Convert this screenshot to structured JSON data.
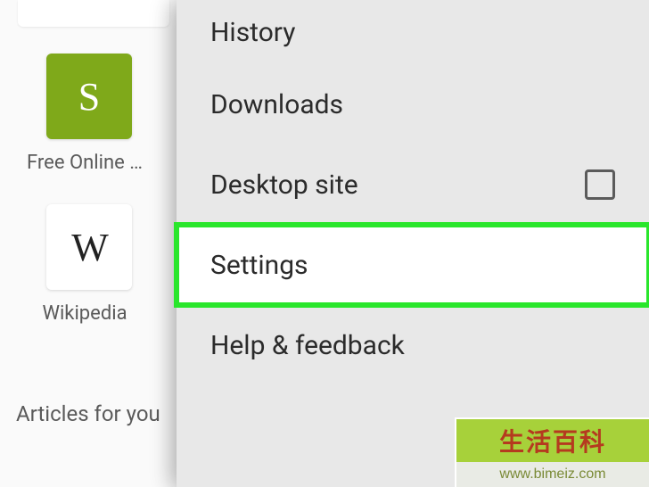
{
  "tiles": [
    {
      "letter": "S",
      "label": "Free Online …",
      "bg": "green"
    },
    {
      "letter": "W",
      "label": "Wikipedia",
      "bg": "white"
    }
  ],
  "section_header": "Articles for you",
  "menu": {
    "items": [
      {
        "label": "History",
        "has_checkbox": false,
        "highlighted": false
      },
      {
        "label": "Downloads",
        "has_checkbox": false,
        "highlighted": false
      },
      {
        "label": "Desktop site",
        "has_checkbox": true,
        "checked": false,
        "highlighted": false
      },
      {
        "label": "Settings",
        "has_checkbox": false,
        "highlighted": true
      },
      {
        "label": "Help & feedback",
        "has_checkbox": false,
        "highlighted": false
      }
    ]
  },
  "watermark": {
    "title": "生活百科",
    "url": "www.bimeiz.com"
  },
  "colors": {
    "highlight_border": "#29e62b",
    "tile_green": "#7fa91a",
    "menu_bg": "#e8e8e8"
  }
}
